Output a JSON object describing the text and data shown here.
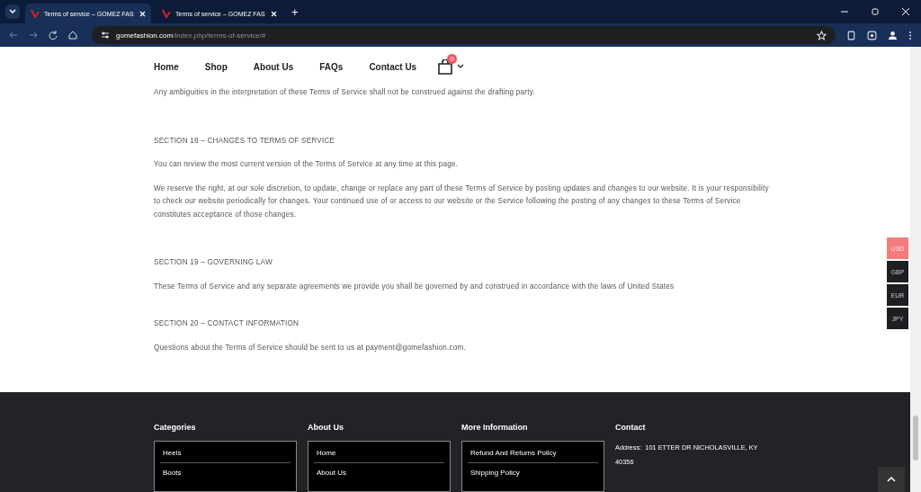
{
  "browser": {
    "tabs": [
      {
        "title": "Terms of service – GOMEZ FAS",
        "selected": true
      },
      {
        "title": "Terms of service – GOMEZ FAS",
        "selected": false
      }
    ],
    "new_tab": "+",
    "url_domain": "gomefashion.com",
    "url_path": "/index.php/terms-of-service/#"
  },
  "nav": {
    "items": [
      "Home",
      "Shop",
      "About Us",
      "FAQs",
      "Contact Us"
    ],
    "cart_count": "0"
  },
  "content": [
    {
      "kind": "para",
      "text": "Any ambiguities in the interpretation of these Terms of Service shall not be construed against the drafting party."
    },
    {
      "kind": "heading",
      "text": "SECTION 18 – CHANGES TO TERMS OF SERVICE"
    },
    {
      "kind": "para",
      "text": "You can review the most current version of the Terms of Service at any time at this page."
    },
    {
      "kind": "para",
      "text": "We reserve the right, at our sole discretion, to update, change or replace any part of these Terms of Service by posting updates and changes to our website. It is your responsibility to check our website periodically for changes. Your continued use of or access to our website or the Service following the posting of any changes to these Terms of Service constitutes acceptance of those changes."
    },
    {
      "kind": "heading",
      "text": "SECTION 19 – GOVERNING LAW"
    },
    {
      "kind": "para",
      "text": "These Terms of Service and any separate agreements we provide you shall be governed by and construed in accordance with the laws of United States"
    },
    {
      "kind": "heading",
      "text": "SECTION 20 – CONTACT INFORMATION"
    },
    {
      "kind": "para",
      "text": "Questions about the Terms of Service should be sent to us at payment@gomefashion.com."
    }
  ],
  "currencies": [
    {
      "code": "USD",
      "selected": true
    },
    {
      "code": "GBP",
      "selected": false
    },
    {
      "code": "EUR",
      "selected": false
    },
    {
      "code": "JPY",
      "selected": false
    }
  ],
  "footer": {
    "columns": [
      {
        "title": "Categories",
        "links": [
          "Heels",
          "Boots"
        ]
      },
      {
        "title": "About Us",
        "links": [
          "Home",
          "About Us"
        ]
      },
      {
        "title": "More Information",
        "links": [
          "Refund And Returns Policy",
          "Shipping Policy"
        ]
      }
    ],
    "contact": {
      "title": "Contact",
      "address_label": "Address:",
      "address": "101 ETTER DR NICHOLASVILLE, KY 40356"
    }
  }
}
